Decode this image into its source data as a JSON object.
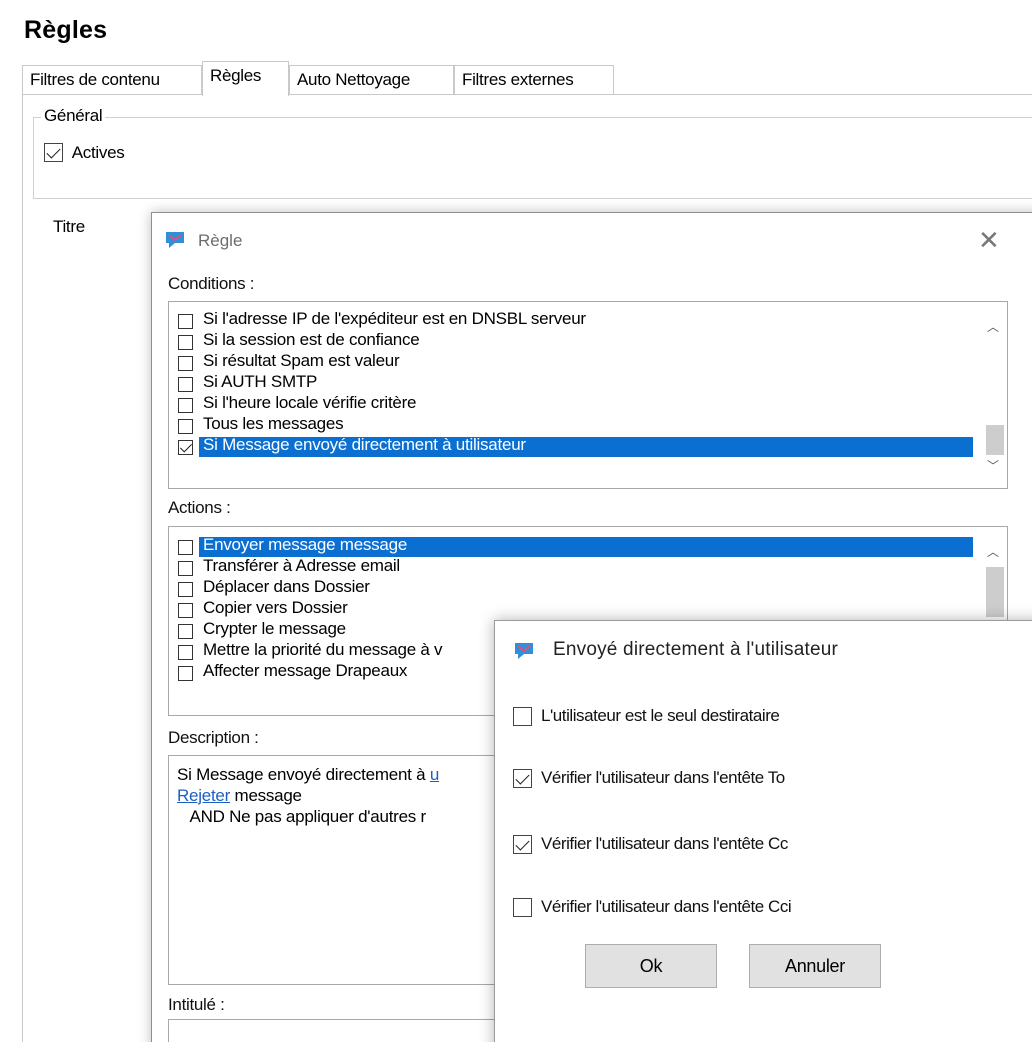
{
  "page": {
    "title": "Règles"
  },
  "tabs": [
    {
      "label": "Filtres de contenu",
      "active": false
    },
    {
      "label": "Règles",
      "active": true
    },
    {
      "label": "Auto Nettoyage",
      "active": false
    },
    {
      "label": "Filtres externes",
      "active": false
    }
  ],
  "general": {
    "legend": "Général",
    "actives_label": "Actives",
    "actives_checked": true
  },
  "titre_label": "Titre",
  "rule_dialog": {
    "title": "Règle",
    "conditions_label": "Conditions :",
    "conditions": [
      {
        "label": "Si l'adresse IP de l'expéditeur est en DNSBL serveur",
        "checked": false,
        "selected": false
      },
      {
        "label": "Si la session est de confiance",
        "checked": false,
        "selected": false
      },
      {
        "label": "Si résultat Spam est valeur",
        "checked": false,
        "selected": false
      },
      {
        "label": "Si AUTH SMTP",
        "checked": false,
        "selected": false
      },
      {
        "label": "Si l'heure locale vérifie critère",
        "checked": false,
        "selected": false
      },
      {
        "label": "Tous les messages",
        "checked": false,
        "selected": false
      },
      {
        "label": "Si Message envoyé directement à utilisateur",
        "checked": true,
        "selected": true
      }
    ],
    "actions_label": "Actions :",
    "actions": [
      {
        "label": "Envoyer message message",
        "checked": false,
        "selected": true
      },
      {
        "label": "Transférer à Adresse email",
        "checked": false,
        "selected": false
      },
      {
        "label": "Déplacer dans Dossier",
        "checked": false,
        "selected": false
      },
      {
        "label": "Copier vers Dossier",
        "checked": false,
        "selected": false
      },
      {
        "label": "Crypter le message",
        "checked": false,
        "selected": false
      },
      {
        "label": "Mettre la priorité du message à v",
        "checked": false,
        "selected": false
      },
      {
        "label": "Affecter message Drapeaux",
        "checked": false,
        "selected": false
      }
    ],
    "description_label": "Description :",
    "description": {
      "line1_text": "Si Message envoyé directement à ",
      "line1_link": "u",
      "line2_link": "Rejeter",
      "line2_text": " message",
      "line3_text": "   AND Ne pas appliquer d'autres r"
    },
    "intitule_label": "Intitulé :"
  },
  "sent_dialog": {
    "title": "Envoyé directement à l'utilisateur",
    "options": [
      {
        "label": "L'utilisateur est le seul destirataire",
        "checked": false
      },
      {
        "label": "Vérifier l'utilisateur dans l'entête To",
        "checked": true
      },
      {
        "label": "Vérifier l'utilisateur dans l'entête Cc",
        "checked": true
      },
      {
        "label": "Vérifier l'utilisateur dans l'entête Cci",
        "checked": false
      }
    ],
    "ok_label": "Ok",
    "cancel_label": "Annuler"
  },
  "icons": {
    "dialog_icon": "chat-bubble-icon",
    "close": "close-icon",
    "scroll_up": "chevron-up-icon",
    "scroll_down": "chevron-down-icon"
  },
  "colors": {
    "selection": "#0a6fd1",
    "link": "#1d5fc5",
    "icon_blue": "#2f8fd8",
    "icon_pink": "#e0507a"
  }
}
